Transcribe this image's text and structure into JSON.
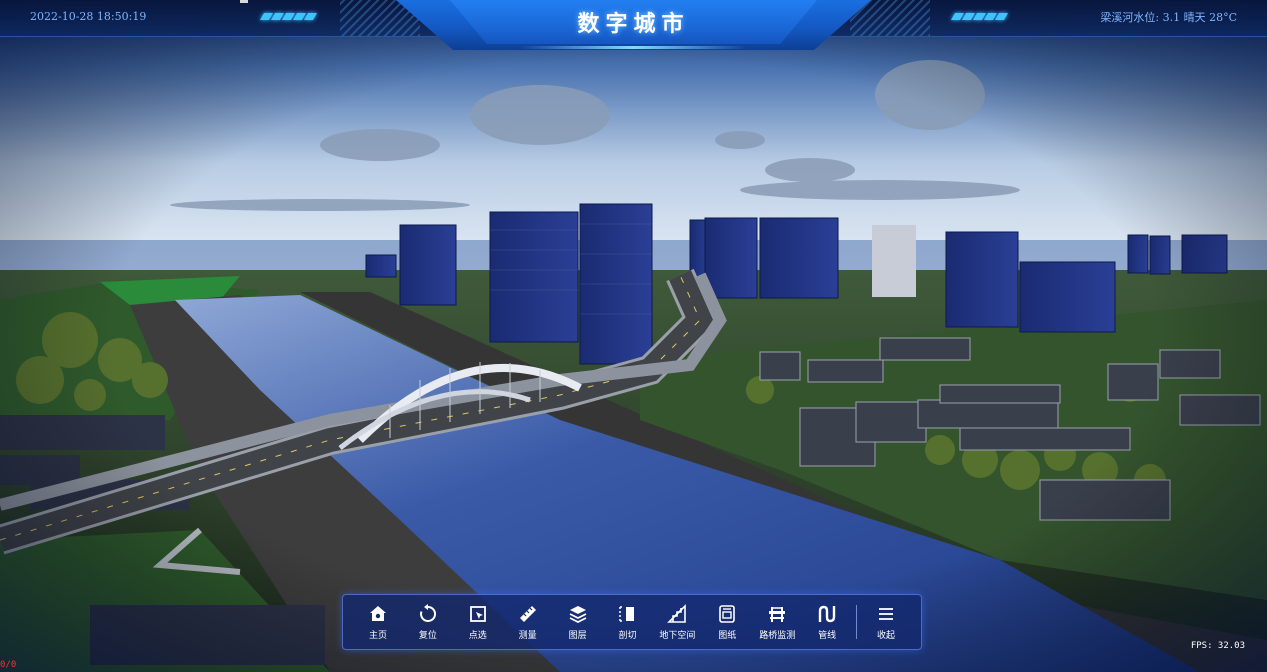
{
  "header": {
    "title": "数字城市",
    "datetime": "2022-10-28 18:50:19",
    "weather": "梁溪河水位: 3.1   晴天 28°C"
  },
  "toolbar": {
    "items": [
      {
        "label": "主页",
        "icon": "home-icon"
      },
      {
        "label": "复位",
        "icon": "reset-icon"
      },
      {
        "label": "点选",
        "icon": "pick-icon"
      },
      {
        "label": "测量",
        "icon": "ruler-icon"
      },
      {
        "label": "图层",
        "icon": "layers-icon"
      },
      {
        "label": "剖切",
        "icon": "section-cut-icon"
      },
      {
        "label": "地下空间",
        "icon": "underground-icon"
      },
      {
        "label": "图纸",
        "icon": "drawing-icon"
      },
      {
        "label": "路桥监测",
        "icon": "bridge-monitor-icon"
      },
      {
        "label": "管线",
        "icon": "pipeline-icon"
      },
      {
        "label": "收起",
        "icon": "collapse-icon"
      }
    ]
  },
  "status": {
    "fps": "FPS: 32.03",
    "counter": "0/0"
  },
  "colors": {
    "title_plate": "#1a6fe0",
    "header_text": "#7fb4ff",
    "toolbar_bg": "#14286e",
    "river": "#2c4fa0",
    "buildings": "#1c2e7a"
  }
}
